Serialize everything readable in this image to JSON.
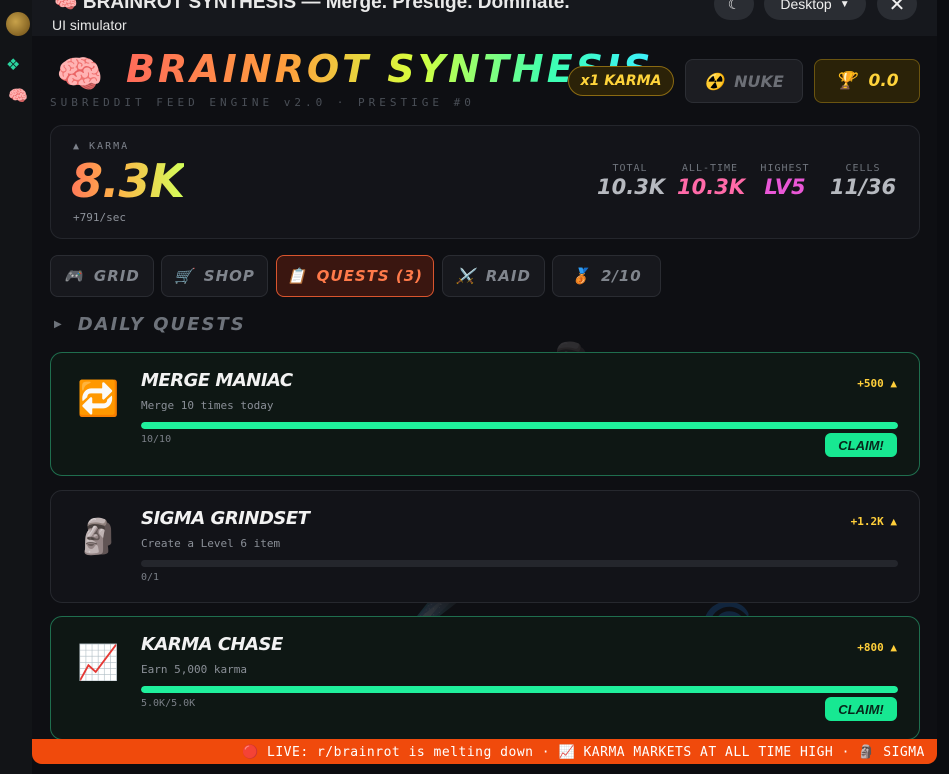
{
  "app": {
    "title": "🧠 BRAINROT SYNTHESIS — Merge. Prestige. Dominate.",
    "subtitle": "UI simulator",
    "device": "Desktop",
    "theme_icon": "moon-icon",
    "close_icon": "close-icon"
  },
  "header": {
    "title": "BRAINROT SYNTHESIS",
    "tagline": "SUBREDDIT FEED ENGINE v2.0 · PRESTIGE #0",
    "multiplier": "x1 KARMA",
    "nuke_label": "NUKE",
    "trophy_value": "0.0",
    "colors": {
      "brand_start": "#ff6b5a",
      "brand_end": "#3df0ff",
      "gold": "#ffd43b"
    }
  },
  "stats": {
    "karma_label": "▲ KARMA",
    "karma_value": "8.3K",
    "karma_rate": "+791/sec",
    "total_label": "TOTAL",
    "total_value": "10.3K",
    "alltime_label": "ALL-TIME",
    "alltime_value": "10.3K",
    "highest_label": "HIGHEST",
    "highest_value": "LV5",
    "cells_label": "CELLS",
    "cells_value": "11/36"
  },
  "tabs": [
    {
      "label": "GRID",
      "icon": "🎮"
    },
    {
      "label": "SHOP",
      "icon": "🛒"
    },
    {
      "label": "QUESTS (3)",
      "icon": "📋"
    },
    {
      "label": "RAID",
      "icon": "⚔️"
    },
    {
      "label": "2/10",
      "icon": "🥉"
    }
  ],
  "active_tab": "QUESTS (3)",
  "section": {
    "caret": "▶",
    "title": "DAILY QUESTS"
  },
  "quests": [
    {
      "icon": "🔁",
      "title": "MERGE MANIAC",
      "desc": "Merge 10 times today",
      "reward": "+500 ▲",
      "progress": "10/10",
      "progress_fraction": 1.0,
      "claim": "CLAIM!"
    },
    {
      "icon": "🗿",
      "title": "SIGMA GRINDSET",
      "desc": "Create a Level 6 item",
      "reward": "+1.2K ▲",
      "progress": "0/1",
      "progress_fraction": 0.0
    },
    {
      "icon": "📈",
      "title": "KARMA CHASE",
      "desc": "Earn 5,000 karma",
      "reward": "+800 ▲",
      "progress": "5.0K/5.0K",
      "progress_fraction": 1.0,
      "claim": "CLAIM!"
    }
  ],
  "ticker": {
    "text": "🔴 LIVE: r/brainrot is melting down · 📈 KARMA MARKETS AT ALL TIME HIGH · 🗿 SIGMA"
  }
}
